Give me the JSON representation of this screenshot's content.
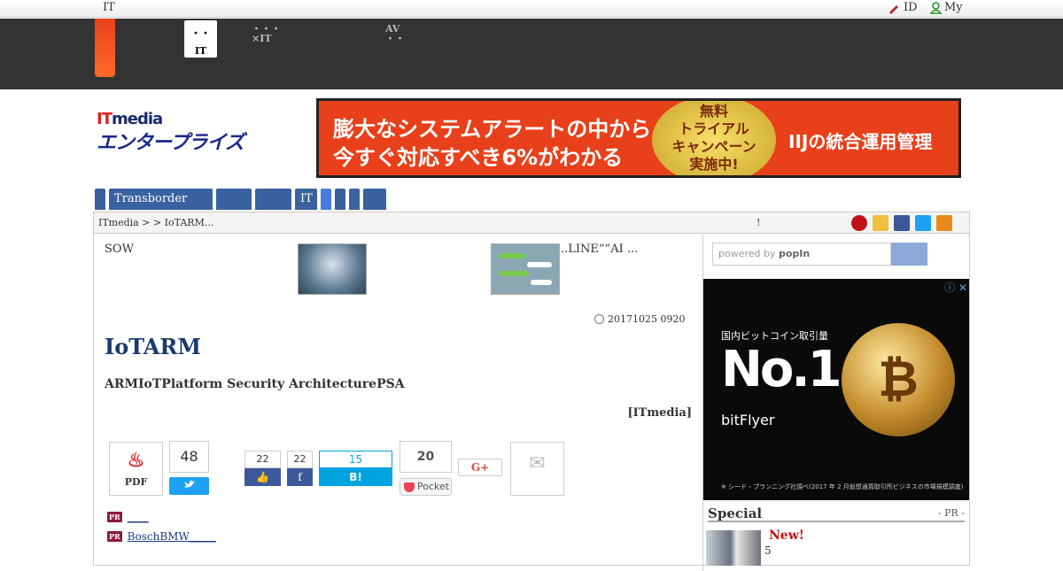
{
  "topbar": {
    "it_label": "IT",
    "id_label": "ID",
    "my_label": "My"
  },
  "netbar": {
    "active_tab": {
      "line1": "・・",
      "line2": "IT"
    },
    "tabs": [
      {
        "line1": "・・・",
        "line2": "×IT"
      },
      {
        "line1": "AV",
        "line2": "・・"
      }
    ]
  },
  "logo": {
    "line1_it": "IT",
    "line1_rest": "media",
    "line2": "エンタープライズ"
  },
  "banner": {
    "line1": "膨大なシステムアラートの中から",
    "line2": "今すぐ対応すべき6%がわかる",
    "seal": [
      "無料",
      "トライアル",
      "キャンペーン",
      "実施中!"
    ],
    "right": "IIJの統合運用管理"
  },
  "categories": [
    "",
    "Transborder",
    "",
    "",
    "IT",
    "",
    "",
    "",
    ""
  ],
  "breadcrumb": {
    "text": "ITmedia  >   > IoTARM...",
    "excl": "!"
  },
  "left": {
    "sow": "SOW",
    "line_text": "..LINE“”AI ...",
    "date": "20171025 0920",
    "title": "IoTARM",
    "subtitle": "ARMIoTPlatform Security ArchitecturePSA",
    "source": "[ITmedia]",
    "pdf_label": "PDF",
    "twitter_count": "48",
    "fb_like_count": "22",
    "fb_share_count": "22",
    "hatena_count": "15",
    "hatena_label": "B! Bookmark",
    "pocket_count": "20",
    "pocket_label": "Pocket",
    "gplus_label": "G+",
    "pr_badge": "PR",
    "pr_links": [
      "____",
      "BoschBMW_____"
    ]
  },
  "right": {
    "search_placeholder_prefix": "powered by ",
    "search_placeholder_brand": "popIn",
    "ad": {
      "small": "国内ビットコイン取引量",
      "big": "No.1",
      "brand": "bitFlyer",
      "coin": "₿",
      "note": "※ シード・プランニング社調べ(2017 年 2 月仮想通貨取引所ビジネスの市場規模調査)"
    },
    "special_title": "Special",
    "special_pr": "- PR -",
    "special_new": "New!",
    "special_num": "5"
  }
}
